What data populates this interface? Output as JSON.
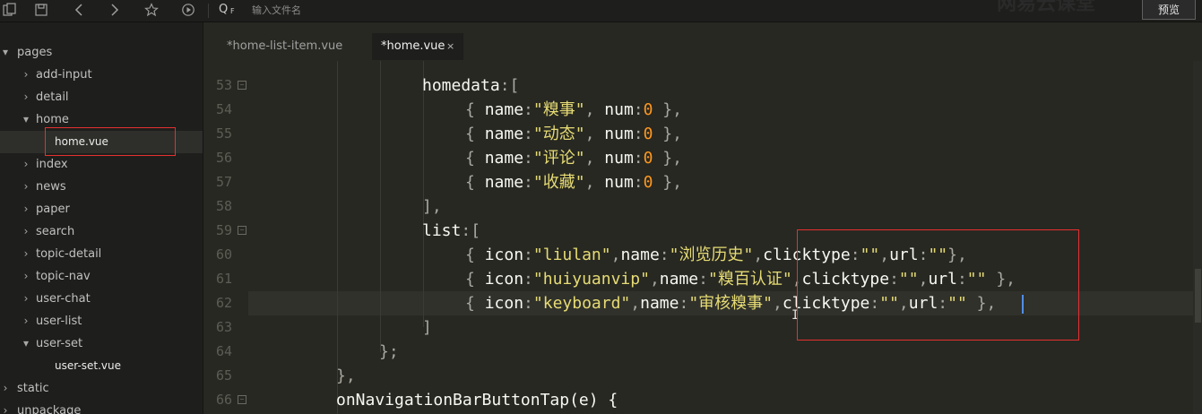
{
  "toolbar": {
    "icons": [
      "copy-icon",
      "save-icon",
      "back-icon",
      "forward-icon",
      "star-icon",
      "run-icon"
    ],
    "search_q": "Q",
    "search_f": "F",
    "search_placeholder": "输入文件名",
    "brand_text": "网易云课堂",
    "preview_label": "预览"
  },
  "sidebar": {
    "items": [
      {
        "label": "pages",
        "arrow": "▾",
        "depth": 0,
        "kind": "folder"
      },
      {
        "label": "add-input",
        "arrow": "›",
        "depth": 1,
        "kind": "folder"
      },
      {
        "label": "detail",
        "arrow": "›",
        "depth": 1,
        "kind": "folder"
      },
      {
        "label": "home",
        "arrow": "▾",
        "depth": 1,
        "kind": "folder"
      },
      {
        "label": "home.vue",
        "arrow": "",
        "depth": 2,
        "kind": "file",
        "selected": true
      },
      {
        "label": "index",
        "arrow": "›",
        "depth": 1,
        "kind": "folder"
      },
      {
        "label": "news",
        "arrow": "›",
        "depth": 1,
        "kind": "folder"
      },
      {
        "label": "paper",
        "arrow": "›",
        "depth": 1,
        "kind": "folder"
      },
      {
        "label": "search",
        "arrow": "›",
        "depth": 1,
        "kind": "folder"
      },
      {
        "label": "topic-detail",
        "arrow": "›",
        "depth": 1,
        "kind": "folder"
      },
      {
        "label": "topic-nav",
        "arrow": "›",
        "depth": 1,
        "kind": "folder"
      },
      {
        "label": "user-chat",
        "arrow": "›",
        "depth": 1,
        "kind": "folder"
      },
      {
        "label": "user-list",
        "arrow": "›",
        "depth": 1,
        "kind": "folder"
      },
      {
        "label": "user-set",
        "arrow": "▾",
        "depth": 1,
        "kind": "folder"
      },
      {
        "label": "user-set.vue",
        "arrow": "",
        "depth": 2,
        "kind": "file"
      },
      {
        "label": "static",
        "arrow": "›",
        "depth": 0,
        "kind": "folder"
      },
      {
        "label": "unpackage",
        "arrow": "›",
        "depth": 0,
        "kind": "folder"
      }
    ]
  },
  "tabs": [
    {
      "label": "*home-list-item.vue",
      "active": false
    },
    {
      "label": "*home.vue",
      "active": true,
      "close": "×"
    }
  ],
  "editor": {
    "lines": [
      {
        "num": "53",
        "fold": "⊟",
        "tokens": [
          [
            "d",
            "homedata"
          ],
          [
            "p",
            ":["
          ]
        ]
      },
      {
        "num": "54",
        "tokens": [
          [
            "p",
            "{ "
          ],
          [
            "d",
            "name"
          ],
          [
            "p",
            ":"
          ],
          [
            "s",
            "\"糗事\""
          ],
          [
            "p",
            ", "
          ],
          [
            "d",
            "num"
          ],
          [
            "p",
            ":"
          ],
          [
            "n",
            "0"
          ],
          [
            "p",
            " },"
          ]
        ]
      },
      {
        "num": "55",
        "tokens": [
          [
            "p",
            "{ "
          ],
          [
            "d",
            "name"
          ],
          [
            "p",
            ":"
          ],
          [
            "s",
            "\"动态\""
          ],
          [
            "p",
            ", "
          ],
          [
            "d",
            "num"
          ],
          [
            "p",
            ":"
          ],
          [
            "n",
            "0"
          ],
          [
            "p",
            " },"
          ]
        ]
      },
      {
        "num": "56",
        "tokens": [
          [
            "p",
            "{ "
          ],
          [
            "d",
            "name"
          ],
          [
            "p",
            ":"
          ],
          [
            "s",
            "\"评论\""
          ],
          [
            "p",
            ", "
          ],
          [
            "d",
            "num"
          ],
          [
            "p",
            ":"
          ],
          [
            "n",
            "0"
          ],
          [
            "p",
            " },"
          ]
        ]
      },
      {
        "num": "57",
        "tokens": [
          [
            "p",
            "{ "
          ],
          [
            "d",
            "name"
          ],
          [
            "p",
            ":"
          ],
          [
            "s",
            "\"收藏\""
          ],
          [
            "p",
            ", "
          ],
          [
            "d",
            "num"
          ],
          [
            "p",
            ":"
          ],
          [
            "n",
            "0"
          ],
          [
            "p",
            " },"
          ]
        ]
      },
      {
        "num": "58",
        "tokens": [
          [
            "p",
            "],"
          ]
        ]
      },
      {
        "num": "59",
        "fold": "⊟",
        "tokens": [
          [
            "d",
            "list"
          ],
          [
            "p",
            ":["
          ]
        ]
      },
      {
        "num": "60",
        "tokens": [
          [
            "p",
            "{ "
          ],
          [
            "d",
            "icon"
          ],
          [
            "p",
            ":"
          ],
          [
            "s",
            "\"liulan\""
          ],
          [
            "p",
            ","
          ],
          [
            "d",
            "name"
          ],
          [
            "p",
            ":"
          ],
          [
            "s",
            "\"浏览历史\""
          ],
          [
            "p",
            ","
          ],
          [
            "d",
            "clicktype"
          ],
          [
            "p",
            ":"
          ],
          [
            "s",
            "\"\""
          ],
          [
            "p",
            ","
          ],
          [
            "d",
            "url"
          ],
          [
            "p",
            ":"
          ],
          [
            "s",
            "\"\""
          ],
          [
            "p",
            "},"
          ]
        ]
      },
      {
        "num": "61",
        "tokens": [
          [
            "p",
            "{ "
          ],
          [
            "d",
            "icon"
          ],
          [
            "p",
            ":"
          ],
          [
            "s",
            "\"huiyuanvip\""
          ],
          [
            "p",
            ","
          ],
          [
            "d",
            "name"
          ],
          [
            "p",
            ":"
          ],
          [
            "s",
            "\"糗百认证\""
          ],
          [
            "p",
            ","
          ],
          [
            "d",
            "clicktype"
          ],
          [
            "p",
            ":"
          ],
          [
            "s",
            "\"\""
          ],
          [
            "p",
            ","
          ],
          [
            "d",
            "url"
          ],
          [
            "p",
            ":"
          ],
          [
            "s",
            "\"\""
          ],
          [
            "p",
            " },"
          ]
        ]
      },
      {
        "num": "62",
        "tokens": [
          [
            "p",
            "{ "
          ],
          [
            "d",
            "icon"
          ],
          [
            "p",
            ":"
          ],
          [
            "s",
            "\"keyboard\""
          ],
          [
            "p",
            ","
          ],
          [
            "d",
            "name"
          ],
          [
            "p",
            ":"
          ],
          [
            "s",
            "\"审核糗事\""
          ],
          [
            "p",
            ","
          ],
          [
            "d",
            "clicktype"
          ],
          [
            "p",
            ":"
          ],
          [
            "s",
            "\"\""
          ],
          [
            "p",
            ","
          ],
          [
            "d",
            "url"
          ],
          [
            "p",
            ":"
          ],
          [
            "s",
            "\"\""
          ],
          [
            "p",
            " },"
          ]
        ]
      },
      {
        "num": "63",
        "tokens": [
          [
            "p",
            "]"
          ]
        ]
      },
      {
        "num": "64",
        "tokens": [
          [
            "p",
            "};"
          ]
        ]
      },
      {
        "num": "65",
        "tokens": [
          [
            "p",
            "},"
          ]
        ]
      },
      {
        "num": "66",
        "fold": "⊟",
        "tokens": [
          [
            "d",
            "onNavigationBarButtonTap(e) {"
          ]
        ]
      }
    ]
  },
  "colors": {
    "background": "#272822",
    "sidebar": "#1e1f1c",
    "string": "#e6db74",
    "number": "#fd971f",
    "default": "#f8f8f2",
    "highlight_box": "#e53030",
    "caret": "#4f8fe8"
  }
}
